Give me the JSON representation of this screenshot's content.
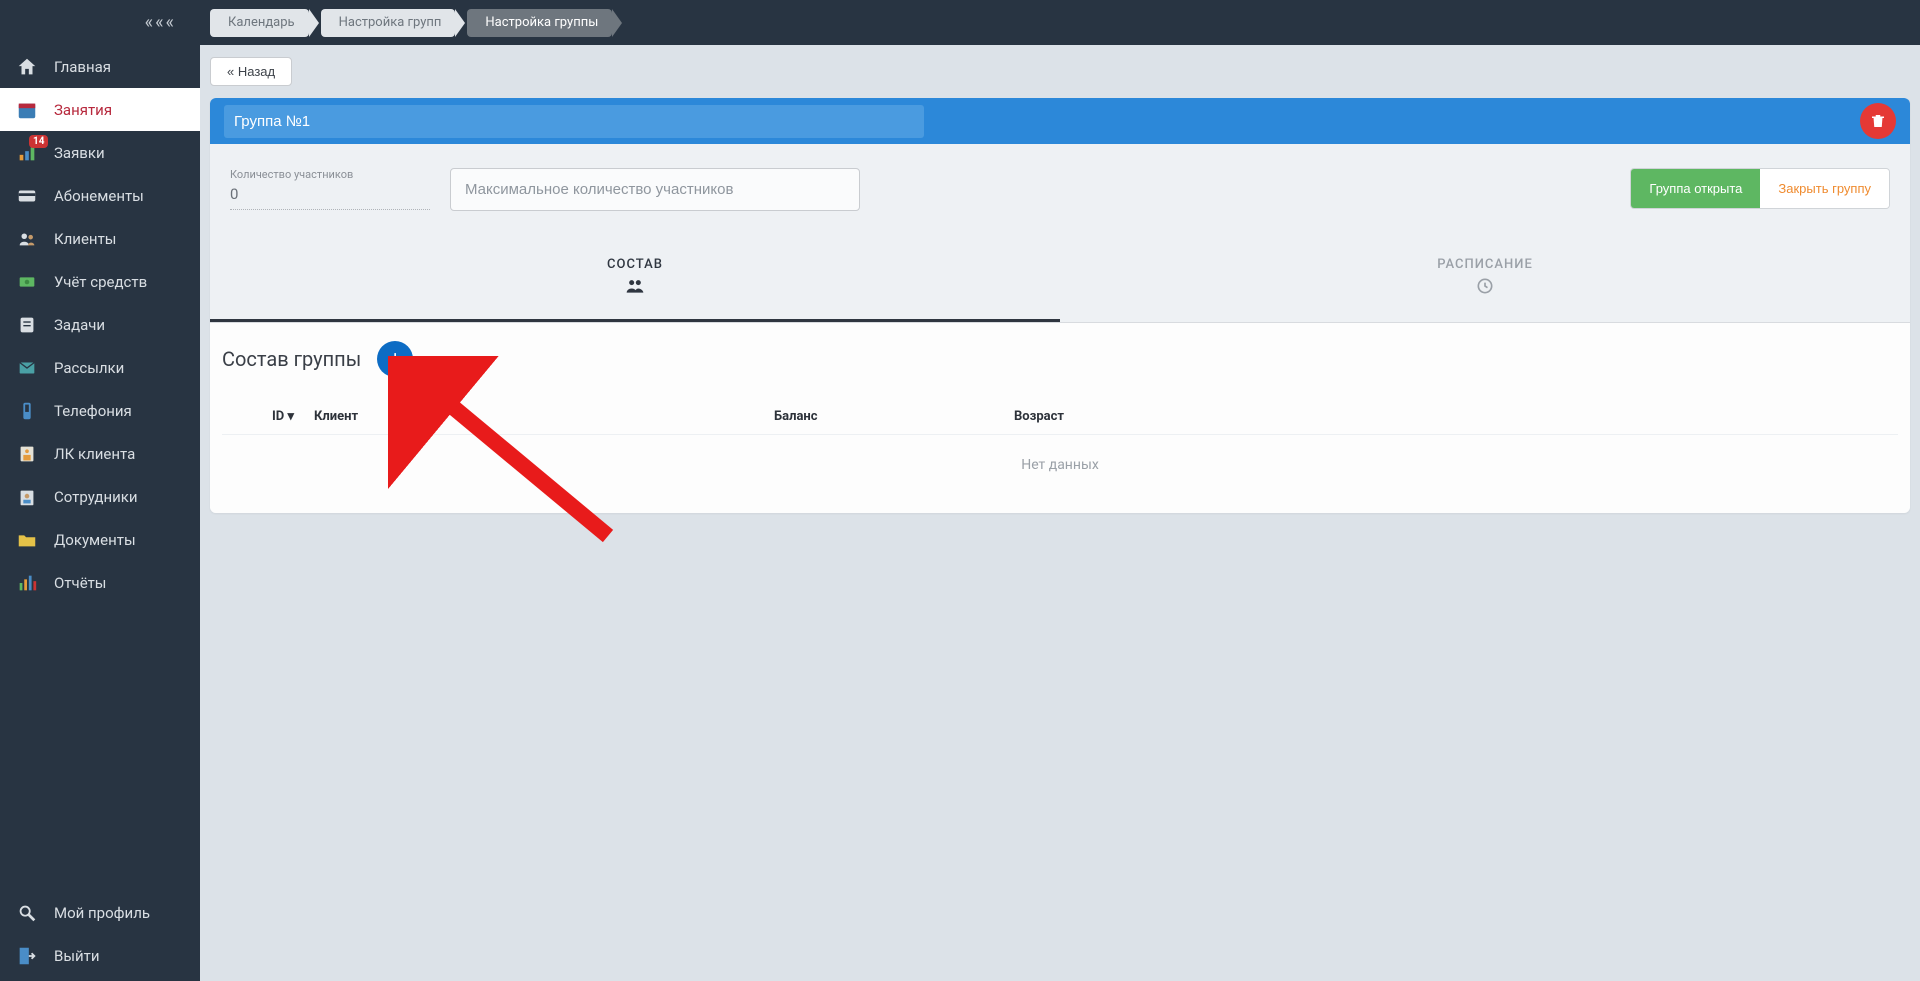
{
  "sidebar": {
    "collapse_glyph": "«««",
    "items": [
      {
        "label": "Главная"
      },
      {
        "label": "Занятия"
      },
      {
        "label": "Заявки",
        "badge": "14"
      },
      {
        "label": "Абонементы"
      },
      {
        "label": "Клиенты"
      },
      {
        "label": "Учёт средств"
      },
      {
        "label": "Задачи"
      },
      {
        "label": "Рассылки"
      },
      {
        "label": "Телефония"
      },
      {
        "label": "ЛК клиента"
      },
      {
        "label": "Сотрудники"
      },
      {
        "label": "Документы"
      },
      {
        "label": "Отчёты"
      }
    ],
    "footer": [
      {
        "label": "Мой профиль"
      },
      {
        "label": "Выйти"
      }
    ]
  },
  "breadcrumb": {
    "items": [
      {
        "label": "Календарь"
      },
      {
        "label": "Настройка групп"
      },
      {
        "label": "Настройка группы"
      }
    ]
  },
  "back_label": "« Назад",
  "group": {
    "name_value": "Группа №1",
    "delete_icon": "trash"
  },
  "form": {
    "count_label": "Количество участников",
    "count_value": "0",
    "max_placeholder": "Максимальное количество участников",
    "status_open": "Группа открыта",
    "status_close": "Закрыть группу"
  },
  "tabs": {
    "members": "СОСТАВ",
    "schedule": "РАСПИСАНИЕ"
  },
  "composition": {
    "title": "Состав группы",
    "add_glyph": "+",
    "columns": {
      "id": "ID",
      "sort_glyph": "▾",
      "client": "Клиент",
      "balance": "Баланс",
      "age": "Возраст"
    },
    "empty": "Нет данных"
  }
}
